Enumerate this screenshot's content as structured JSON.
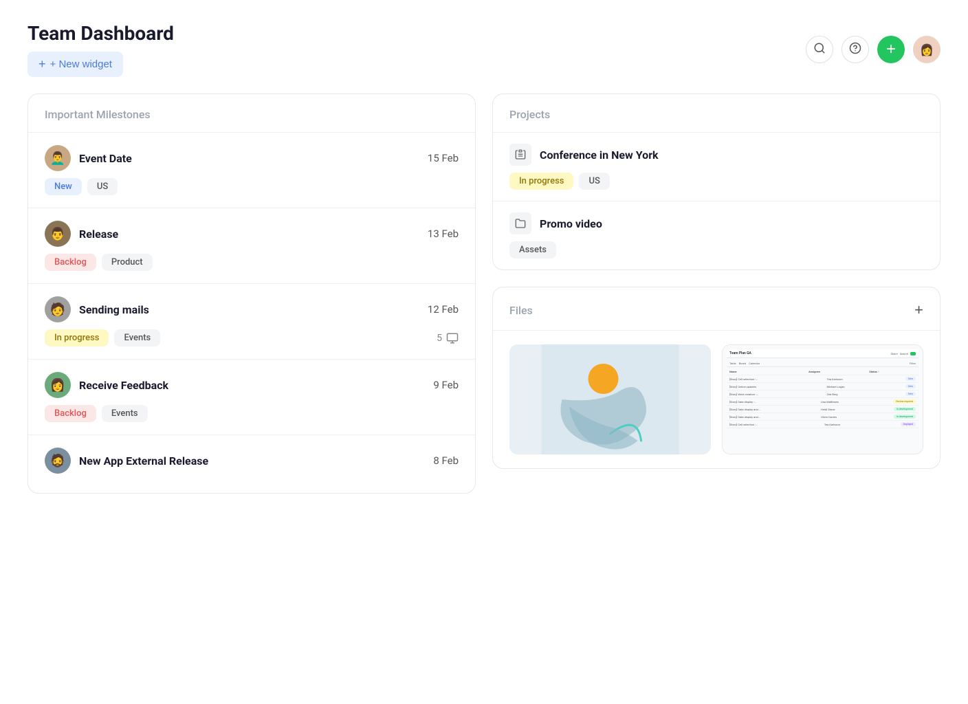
{
  "header": {
    "title": "Team Dashboard",
    "new_widget_label": "+ New widget",
    "search_icon": "search",
    "help_icon": "?",
    "add_icon": "+",
    "avatar_icon": "👩"
  },
  "milestones": {
    "section_title": "Important Milestones",
    "items": [
      {
        "name": "Event Date",
        "date": "15 Feb",
        "tags": [
          {
            "label": "New",
            "type": "new"
          },
          {
            "label": "US",
            "type": "us"
          }
        ],
        "avatar_emoji": "👨‍🦱"
      },
      {
        "name": "Release",
        "date": "13 Feb",
        "tags": [
          {
            "label": "Backlog",
            "type": "backlog"
          },
          {
            "label": "Product",
            "type": "product"
          }
        ],
        "avatar_emoji": "👨‍🦿"
      },
      {
        "name": "Sending mails",
        "date": "12 Feb",
        "tags": [
          {
            "label": "In progress",
            "type": "inprogress"
          },
          {
            "label": "Events",
            "type": "events"
          }
        ],
        "extra": "5",
        "avatar_emoji": "🧑"
      },
      {
        "name": "Receive Feedback",
        "date": "9 Feb",
        "tags": [
          {
            "label": "Backlog",
            "type": "backlog"
          },
          {
            "label": "Events",
            "type": "events"
          }
        ],
        "avatar_emoji": "👩"
      },
      {
        "name": "New App External Release",
        "date": "8 Feb",
        "tags": [],
        "avatar_emoji": "🧔"
      }
    ]
  },
  "projects": {
    "section_title": "Projects",
    "items": [
      {
        "name": "Conference in New York",
        "icon": "📋",
        "tags": [
          {
            "label": "In progress",
            "type": "inprogress"
          },
          {
            "label": "US",
            "type": "us"
          }
        ]
      },
      {
        "name": "Promo video",
        "icon": "📁",
        "tags": [
          {
            "label": "Assets",
            "type": "assets"
          }
        ]
      }
    ]
  },
  "files": {
    "section_title": "Files",
    "add_icon": "+",
    "items": [
      {
        "type": "art",
        "label": "Abstract art file"
      },
      {
        "type": "screenshot",
        "label": "Team Plan GA screenshot"
      }
    ]
  },
  "mini_screenshot": {
    "title": "Team Plan GA",
    "rows": [
      {
        "name": "[Story] Cell selection -...",
        "assignee": "Tea Karlsson",
        "status": "New",
        "status_type": "new"
      },
      {
        "name": "[Story] Online updates",
        "assignee": "Michael Logan",
        "status": "New",
        "status_type": "new"
      },
      {
        "name": "[Story] Work creation -...",
        "assignee": "Zeb Berg",
        "status": "New",
        "status_type": "new"
      },
      {
        "name": "[Story] Data display -...",
        "assignee": "Lisa Matthews",
        "status": "Review required",
        "status_type": "review"
      },
      {
        "name": "[Story] Data display and...",
        "assignee": "Heidi Stone",
        "status": "In development",
        "status_type": "indev"
      },
      {
        "name": "[Story] Data display and...",
        "assignee": "Oliver Davies",
        "status": "In development",
        "status_type": "indev"
      },
      {
        "name": "[Story] Cell selection -...",
        "assignee": "Tea Karlsson",
        "status": "Deployed",
        "status_type": "deployed"
      }
    ]
  }
}
